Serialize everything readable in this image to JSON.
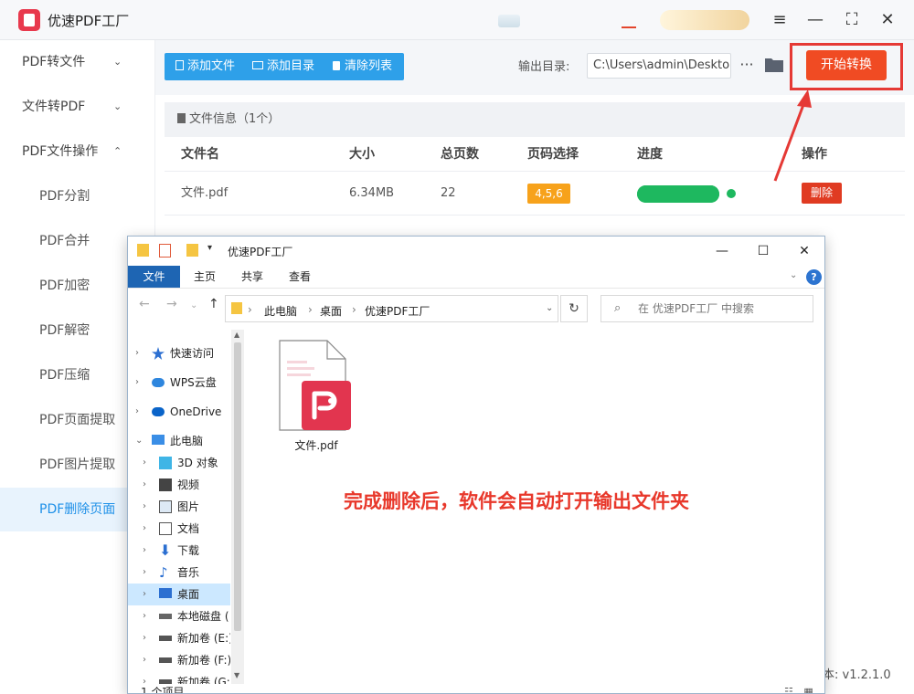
{
  "app": {
    "title": "优速PDF工厂"
  },
  "window_controls": {
    "menu": "≡",
    "minimize": "—",
    "maximize": "⛶",
    "close": "✕"
  },
  "sidebar": {
    "items": [
      {
        "label": "PDF转文件",
        "chevron": "⌄"
      },
      {
        "label": "文件转PDF",
        "chevron": "⌄"
      },
      {
        "label": "PDF文件操作",
        "chevron": "⌃"
      },
      {
        "label": "PDF分割"
      },
      {
        "label": "PDF合并"
      },
      {
        "label": "PDF加密"
      },
      {
        "label": "PDF解密"
      },
      {
        "label": "PDF压缩"
      },
      {
        "label": "PDF页面提取"
      },
      {
        "label": "PDF图片提取"
      },
      {
        "label": "PDF删除页面",
        "active": true
      }
    ]
  },
  "toolbar": {
    "add_file": "添加文件",
    "add_dir": "添加目录",
    "clear_list": "清除列表",
    "output_label": "输出目录:",
    "output_path": "C:\\Users\\admin\\Desktop",
    "more": "···",
    "start": "开始转换"
  },
  "file_panel": {
    "header": "文件信息（1个）",
    "columns": [
      "文件名",
      "大小",
      "总页数",
      "页码选择",
      "进度",
      "操作"
    ],
    "rows": [
      {
        "name": "文件.pdf",
        "size": "6.34MB",
        "pages": "22",
        "page_select": "4,5,6",
        "progress": 1.0,
        "action": "删除"
      }
    ]
  },
  "version": "本: v1.2.1.0",
  "explorer": {
    "title": "优速PDF工厂",
    "tabs": [
      "文件",
      "主页",
      "共享",
      "查看"
    ],
    "breadcrumb": [
      "此电脑",
      "桌面",
      "优速PDF工厂"
    ],
    "search_placeholder": "在 优速PDF工厂 中搜索",
    "nav": [
      {
        "label": "快速访问",
        "icon": "star-icon"
      },
      {
        "label": "WPS云盘",
        "icon": "cloud-icon"
      },
      {
        "label": "OneDrive",
        "icon": "onedrive-icon"
      },
      {
        "label": "此电脑",
        "icon": "computer-icon"
      },
      {
        "label": "3D 对象",
        "icon": "cube-icon"
      },
      {
        "label": "视频",
        "icon": "video-icon"
      },
      {
        "label": "图片",
        "icon": "picture-icon"
      },
      {
        "label": "文档",
        "icon": "document-icon"
      },
      {
        "label": "下载",
        "icon": "download-icon"
      },
      {
        "label": "音乐",
        "icon": "music-icon"
      },
      {
        "label": "桌面",
        "icon": "desktop-icon",
        "selected": true
      },
      {
        "label": "本地磁盘 (",
        "icon": "disk-icon"
      },
      {
        "label": "新加卷 (E:)",
        "icon": "drive-icon"
      },
      {
        "label": "新加卷 (F:)",
        "icon": "drive-icon"
      },
      {
        "label": "新加卷 (G:",
        "icon": "drive-icon"
      }
    ],
    "file": {
      "name": "文件.pdf"
    },
    "notice": "完成删除后，软件会自动打开输出文件夹",
    "status": "1 个项目"
  },
  "colors": {
    "accent": "#2ea0e9",
    "start": "#f04b23",
    "highlight": "#e53935",
    "progress": "#1eb85f",
    "badge": "#f7a21b"
  }
}
